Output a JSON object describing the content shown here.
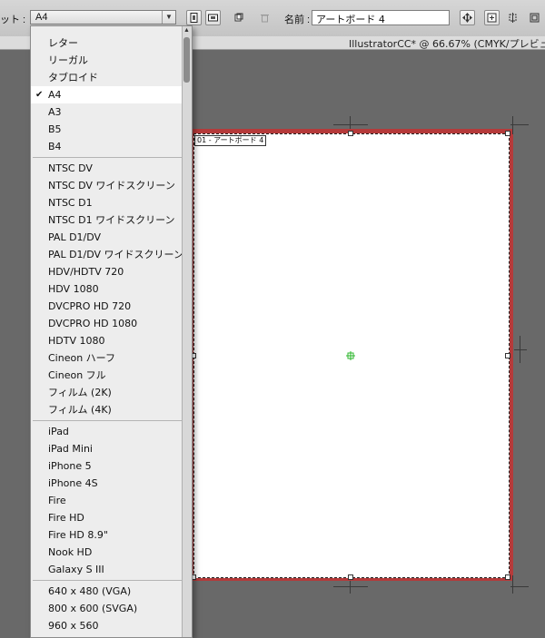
{
  "controlbar": {
    "preset_label": "ット :",
    "preset_value": "A4",
    "name_label": "名前 :",
    "name_value": "アートボード 4"
  },
  "document": {
    "title": "IllustratorCC* @ 66.67% (CMYK/プレビュ"
  },
  "artboard": {
    "label": "01 - アートボード 4"
  },
  "dropdown": {
    "selected": "A4",
    "items": [
      "レター",
      "リーガル",
      "タブロイド",
      "A4",
      "A3",
      "B5",
      "B4",
      "NTSC DV",
      "NTSC DV ワイドスクリーン",
      "NTSC D1",
      "NTSC D1 ワイドスクリーン",
      "PAL D1/DV",
      "PAL D1/DV ワイドスクリーン",
      "HDV/HDTV 720",
      "HDV 1080",
      "DVCPRO HD 720",
      "DVCPRO HD 1080",
      "HDTV 1080",
      "Cineon ハーフ",
      "Cineon フル",
      "フィルム (2K)",
      "フィルム (4K)",
      "iPad",
      "iPad Mini",
      "iPhone 5",
      "iPhone 4S",
      "Fire",
      "Fire HD",
      "Fire HD 8.9\"",
      "Nook HD",
      "Galaxy S III",
      "640 x 480 (VGA)",
      "800 x 600 (SVGA)",
      "960 x 560"
    ]
  },
  "colors": {
    "canvas": "#696969",
    "artboard_border": "#b53a3a",
    "menu_bg": "#ededed",
    "center_mark": "#2bb52b"
  }
}
